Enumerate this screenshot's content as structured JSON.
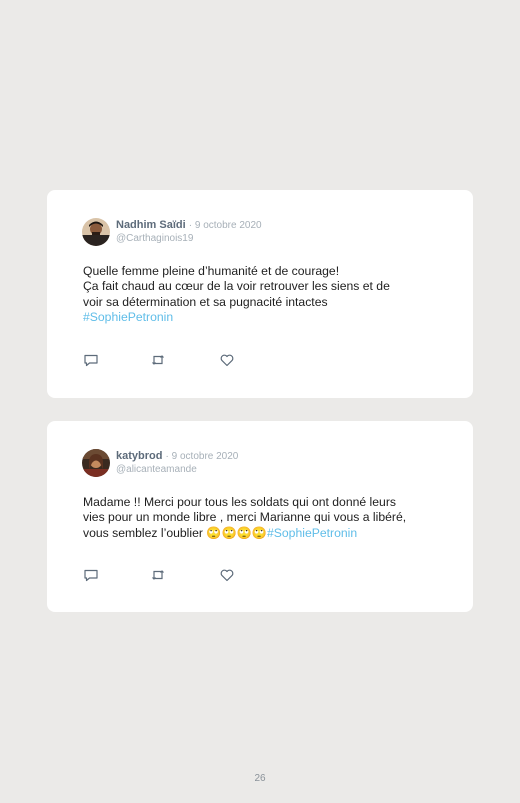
{
  "tweets": [
    {
      "author": "Nadhim Saïdi",
      "date": "· 9 octobre 2020",
      "handle": "@Carthaginois19",
      "lines": [
        "Quelle femme pleine d’humanité et de courage!",
        "Ça fait chaud au cœur de la voir retrouver les siens et de",
        "voir sa détermination et sa pugnacité intactes"
      ],
      "hashtag": "#SophiePetronin"
    },
    {
      "author": "katybrod",
      "date": "· 9 octobre 2020",
      "handle": "@alicanteamande",
      "lines": [
        "Madame !! Merci pour tous les soldats qui ont donné leurs",
        "vies pour un monde libre , merci Marianne qui vous a libéré,"
      ],
      "last_line_text": "vous semblez l’oublier ",
      "emojis": "🙄🙄🙄🙄",
      "hashtag": "#SophiePetronin"
    }
  ],
  "icons": {
    "reply": "comment-icon",
    "retweet": "retweet-icon",
    "like": "heart-icon"
  },
  "colors": {
    "background": "#ebeae8",
    "card": "#ffffff",
    "hashtag": "#5fbde8",
    "author": "#5d6b7a",
    "muted": "#a7b0b8"
  },
  "page_number": "26"
}
